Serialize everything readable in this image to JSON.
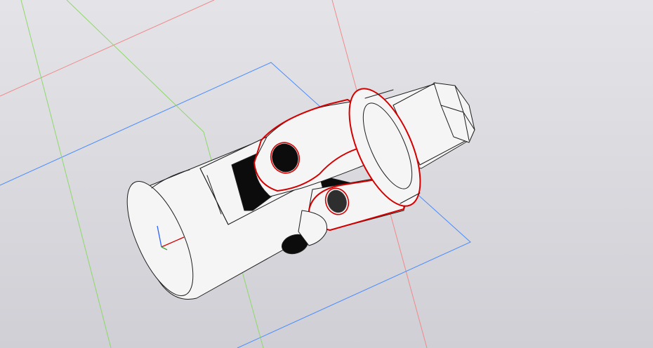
{
  "viewport": {
    "background_top": "#e4e4e8",
    "background_bottom": "#cfcfd5"
  },
  "colors": {
    "body_fill": "#f5f5f5",
    "edge": "#1e1e1e",
    "hole_fill": "#0c0c0c",
    "selection": "#d40000",
    "plane_zx": "#f08a8a",
    "plane_xy": "#4a8cff",
    "plane_yz": "#8ed86a"
  },
  "model": {
    "part": "universal-joint",
    "selected_faces": [
      "yoke-outer-face",
      "yoke-pin-hole",
      "shaft-ring-face"
    ]
  },
  "axis_triad": {
    "x_color": "#d40000",
    "y_color": "#3aa03a",
    "z_color": "#2a62ff"
  }
}
